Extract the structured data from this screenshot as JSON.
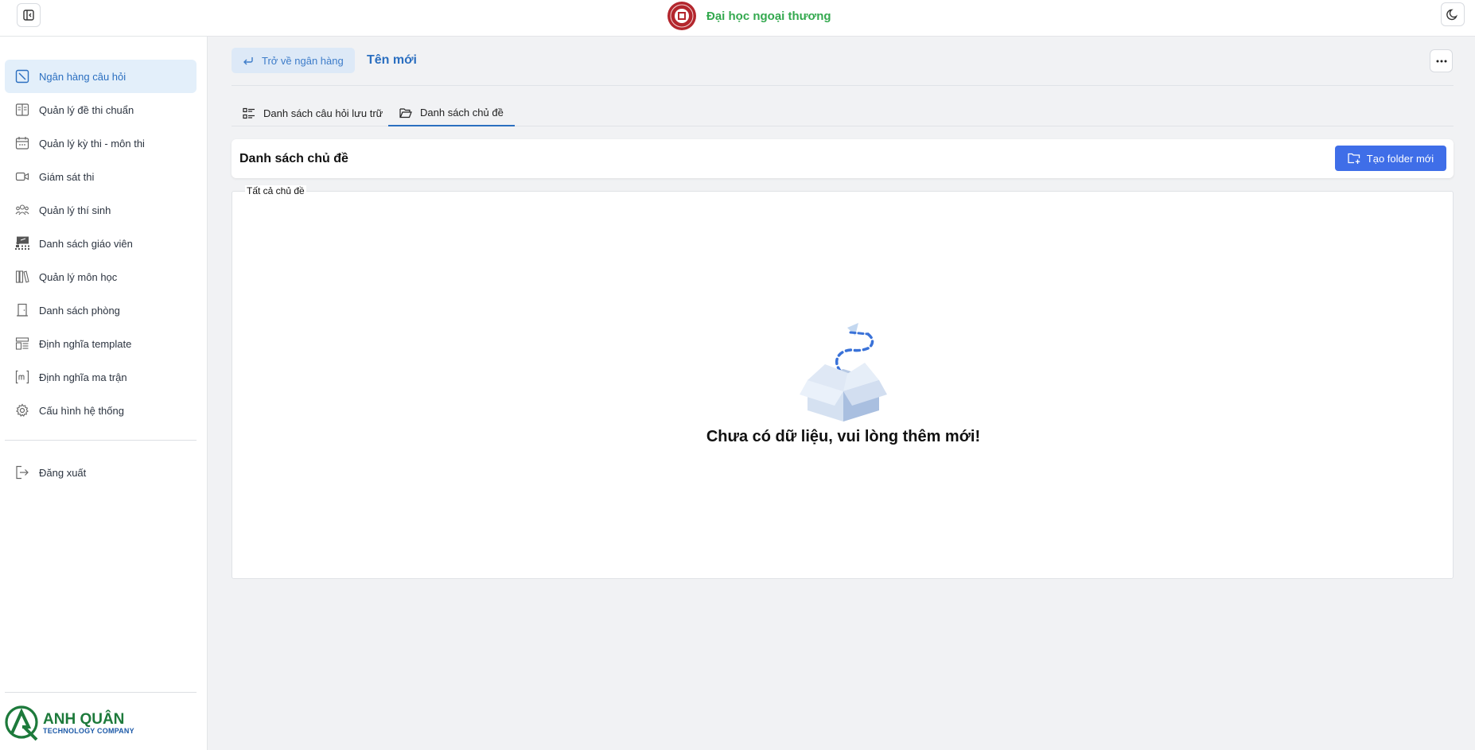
{
  "brand": {
    "name": "Đại học ngoại thương"
  },
  "sidebar": {
    "items": [
      {
        "label": "Ngân hàng câu hỏi",
        "icon": "question-bank-icon",
        "active": true
      },
      {
        "label": "Quản lý đề thi chuẩn",
        "icon": "book-open-icon"
      },
      {
        "label": "Quản lý kỳ thi - môn thi",
        "icon": "calendar-icon"
      },
      {
        "label": "Giám sát thi",
        "icon": "video-camera-icon"
      },
      {
        "label": "Quản lý thí sinh",
        "icon": "users-icon"
      },
      {
        "label": "Danh sách giáo viên",
        "icon": "teacher-icon"
      },
      {
        "label": "Quản lý môn học",
        "icon": "library-icon"
      },
      {
        "label": "Danh sách phòng",
        "icon": "door-icon"
      },
      {
        "label": "Định nghĩa template",
        "icon": "template-icon"
      },
      {
        "label": "Định nghĩa ma trận",
        "icon": "matrix-icon"
      },
      {
        "label": "Cấu hình hệ thống",
        "icon": "gear-icon"
      }
    ],
    "logout_label": "Đăng xuất",
    "company": {
      "name": "ANH QUÂN",
      "subtitle": "TECHNOLOGY COMPANY"
    }
  },
  "main": {
    "back_label": "Trở về ngân hàng",
    "title": "Tên mới",
    "tabs": [
      {
        "label": "Danh sách câu hỏi lưu trữ",
        "icon": "list-icon"
      },
      {
        "label": "Danh sách chủ đề",
        "icon": "folder-open-icon",
        "active": true
      }
    ],
    "list_title": "Danh sách chủ đề",
    "new_folder_label": "Tạo folder mới",
    "panel_legend": "Tất cả chủ đề",
    "empty_message": "Chưa có dữ liệu, vui lòng thêm mới!"
  },
  "colors": {
    "accent": "#2b6fc0",
    "primary_button": "#3f6ee8",
    "brand_green": "#34a94f"
  }
}
